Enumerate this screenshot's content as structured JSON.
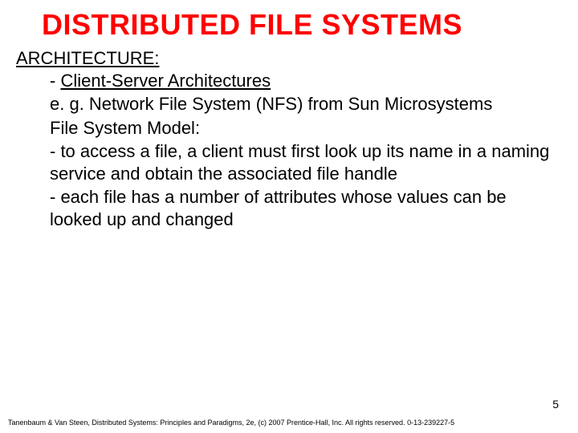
{
  "slide": {
    "title": "DISTRIBUTED FILE SYSTEMS",
    "heading": "ARCHITECTURE:",
    "subhead_dash": "- ",
    "subhead_text": "Client-Server Architectures",
    "line1": "e. g. Network File System (NFS) from Sun Microsystems",
    "line2": "File System Model:",
    "line3": "- to access a file, a client must first look up its name in a naming service and obtain the associated file handle",
    "line4": "- each file has a number of attributes whose values can be looked up and changed",
    "page_number": "5",
    "footer": "Tanenbaum & Van Steen, Distributed Systems: Principles and Paradigms, 2e, (c) 2007 Prentice-Hall, Inc. All rights reserved. 0-13-239227-5"
  }
}
